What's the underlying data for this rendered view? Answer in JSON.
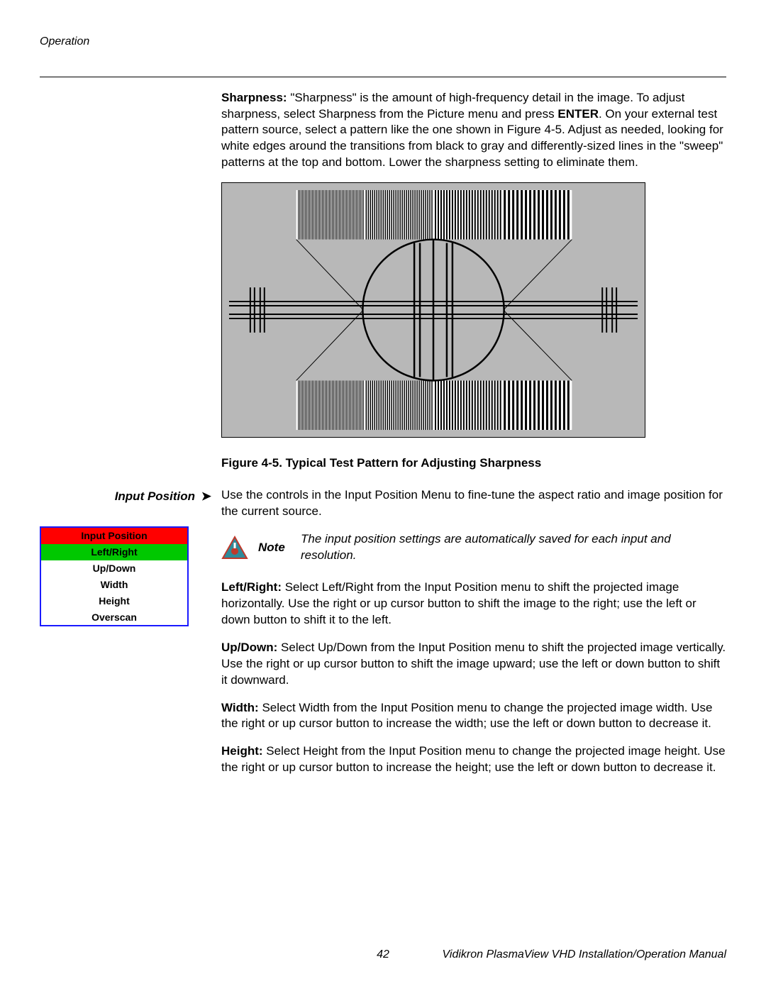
{
  "header": {
    "section": "Operation"
  },
  "sharpness": {
    "label": "Sharpness:",
    "text_before_enter": " \"Sharpness\" is the amount of high-frequency detail in the image. To adjust sharpness, select Sharpness from the Picture menu and press ",
    "enter": "ENTER",
    "text_after_enter": ". On your external test pattern source, select a pattern like the one shown in Figure 4-5. Adjust as needed, looking for white edges around the transitions from black to gray and differently-sized lines in the \"sweep\" patterns at the top and bottom. Lower the sharpness setting to eliminate them."
  },
  "figure_caption": "Figure 4-5. Typical Test Pattern for Adjusting Sharpness",
  "side_heading": "Input Position",
  "input_position_intro": "Use the controls in the Input Position Menu to fine-tune the aspect ratio and image position for the current source.",
  "menu": {
    "title": "Input Position",
    "selected": "Left/Right",
    "items": [
      "Up/Down",
      "Width",
      "Height",
      "Overscan"
    ]
  },
  "note": {
    "label": "Note",
    "text": "The input position settings are automatically saved for each input and resolution."
  },
  "left_right": {
    "label": "Left/Right:",
    "text": " Select Left/Right from the Input Position menu to shift the projected image horizontally. Use the right or up cursor button to shift the image to the right; use the left or down button to shift it to the left."
  },
  "up_down": {
    "label": "Up/Down:",
    "text": " Select Up/Down from the Input Position menu to shift the projected image vertically. Use the right or up cursor button to shift the image upward; use the left or down button to shift it downward."
  },
  "width": {
    "label": "Width:",
    "text": " Select Width from the Input Position menu to change the projected image width. Use the right or up cursor button to increase the width; use the left or down button to decrease it."
  },
  "height": {
    "label": "Height:",
    "text": " Select Height from the Input Position menu to change the projected image height. Use the right or up cursor button to increase the height; use the left or down button to decrease it."
  },
  "footer": {
    "page": "42",
    "title": "Vidikron PlasmaView VHD Installation/Operation Manual"
  }
}
